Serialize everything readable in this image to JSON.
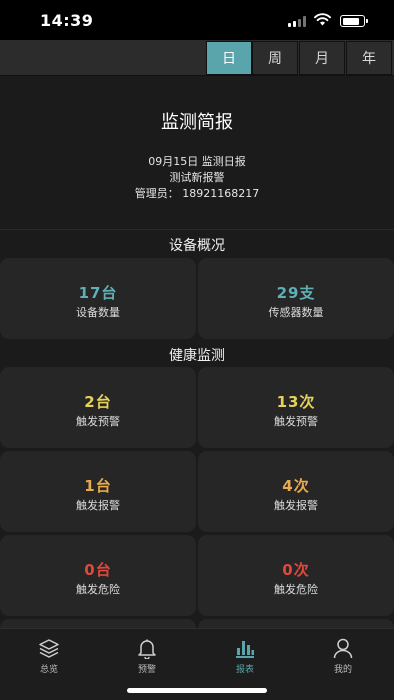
{
  "status_bar": {
    "time": "14:39",
    "battery_level": 0.85
  },
  "period_tabs": [
    {
      "label": "日",
      "active": true
    },
    {
      "label": "周",
      "active": false
    },
    {
      "label": "月",
      "active": false
    },
    {
      "label": "年",
      "active": false
    }
  ],
  "report": {
    "title": "监测简报",
    "date_line": "09月15日 监测日报",
    "subtitle": "测试新报警",
    "manager_line": "管理员：  18921168217"
  },
  "device_overview": {
    "title": "设备概况",
    "cards": [
      {
        "value": "17台",
        "label": "设备数量",
        "color": "#5fb0b6"
      },
      {
        "value": "29支",
        "label": "传感器数量",
        "color": "#5fb0b6"
      }
    ]
  },
  "health_monitoring": {
    "title": "健康监测",
    "cards": [
      {
        "value": "2台",
        "label": "触发预警",
        "color": "#e6d25b"
      },
      {
        "value": "13次",
        "label": "触发预警",
        "color": "#e6d25b"
      },
      {
        "value": "1台",
        "label": "触发报警",
        "color": "#e9a94f"
      },
      {
        "value": "4次",
        "label": "触发报警",
        "color": "#e9a94f"
      },
      {
        "value": "0台",
        "label": "触发危险",
        "color": "#e0483c"
      },
      {
        "value": "0次",
        "label": "触发危险",
        "color": "#e0483c"
      }
    ]
  },
  "tabbar": [
    {
      "label": "总览",
      "icon": "layers-icon",
      "active": false
    },
    {
      "label": "预警",
      "icon": "bell-icon",
      "active": false
    },
    {
      "label": "报表",
      "icon": "bar-chart-icon",
      "active": true
    },
    {
      "label": "我的",
      "icon": "user-icon",
      "active": false
    }
  ],
  "colors": {
    "accent": "#59a5ab",
    "background": "#1b1b1b",
    "card": "#262626"
  }
}
